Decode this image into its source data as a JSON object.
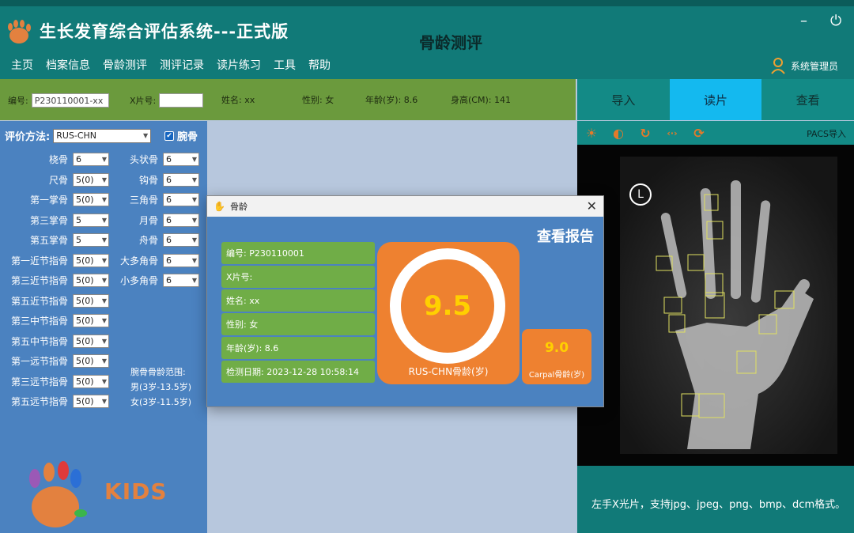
{
  "header": {
    "app_title": "生长发育综合评估系统---正式版",
    "page_heading": "骨龄测评",
    "menu": [
      "主页",
      "档案信息",
      "骨龄测评",
      "测评记录",
      "读片练习",
      "工具",
      "帮助"
    ],
    "user_name": "系统管理员",
    "minimize_label": "–",
    "power_label": "⏻"
  },
  "infobar": {
    "id_label": "编号:",
    "id_value": "P230110001-xx",
    "xray_label": "X片号:",
    "xray_value": "",
    "name_label": "姓名: xx",
    "gender_label": "性别: 女",
    "age_label": "年龄(岁): 8.6",
    "height_label": "身高(CM): 141"
  },
  "tabs": [
    "导入",
    "读片",
    "查看"
  ],
  "active_tab": "读片",
  "method": {
    "label": "评价方法:",
    "value": "RUS-CHN",
    "wrist_label": "腕骨",
    "wrist_checked": true
  },
  "bones_left": [
    {
      "label": "桡骨",
      "value": "6"
    },
    {
      "label": "尺骨",
      "value": "5(0)"
    },
    {
      "label": "第一掌骨",
      "value": "5(0)"
    },
    {
      "label": "第三掌骨",
      "value": "5"
    },
    {
      "label": "第五掌骨",
      "value": "5"
    },
    {
      "label": "第一近节指骨",
      "value": "5(0)"
    },
    {
      "label": "第三近节指骨",
      "value": "5(0)"
    },
    {
      "label": "第五近节指骨",
      "value": "5(0)"
    },
    {
      "label": "第三中节指骨",
      "value": "5(0)"
    },
    {
      "label": "第五中节指骨",
      "value": "5(0)"
    },
    {
      "label": "第一远节指骨",
      "value": "5(0)"
    },
    {
      "label": "第三远节指骨",
      "value": "5(0)"
    },
    {
      "label": "第五远节指骨",
      "value": "5(0)"
    }
  ],
  "bones_right": [
    {
      "label": "头状骨",
      "value": "6"
    },
    {
      "label": "钩骨",
      "value": "6"
    },
    {
      "label": "三角骨",
      "value": "6"
    },
    {
      "label": "月骨",
      "value": "6"
    },
    {
      "label": "舟骨",
      "value": "6"
    },
    {
      "label": "大多角骨",
      "value": "6"
    },
    {
      "label": "小多角骨",
      "value": "6"
    }
  ],
  "range": {
    "title": "腕骨骨龄范围:",
    "male": "男(3岁-13.5岁)",
    "female": "女(3岁-11.5岁)"
  },
  "kids_text": "KIDS",
  "toolbar": {
    "pacs_label": "PACS导入",
    "tools": [
      "brightness-icon",
      "contrast-icon",
      "rotate-icon",
      "flip-icon",
      "refresh-icon"
    ]
  },
  "xray_marker": "L",
  "footnote": "左手X光片，支持jpg、jpeg、png、bmp、dcm格式。",
  "dialog": {
    "title": "骨龄",
    "heading": "查看报告",
    "fields": [
      "编号: P230110001",
      "X片号:",
      "姓名: xx",
      "性别: 女",
      "年龄(岁): 8.6",
      "检测日期: 2023-12-28 10:58:14"
    ],
    "rus_value": "9.5",
    "rus_label": "RUS-CHN骨龄(岁)",
    "carpal_value": "9.0",
    "carpal_label": "Carpal骨龄(岁)"
  },
  "colors": {
    "header_teal": "#117a78",
    "info_green": "#6b9a3d",
    "active_tab": "#14b9ef",
    "panel_blue": "#4b82c0",
    "orange": "#ee8130",
    "value_yellow": "#ffd000",
    "field_green": "#70ad47"
  }
}
